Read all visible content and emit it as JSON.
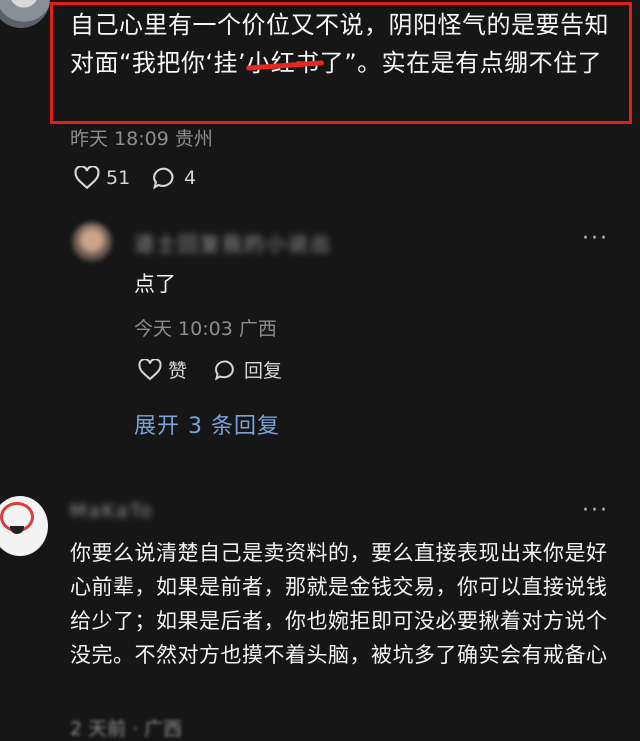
{
  "comment_main": {
    "text_before": "自己心里有一个价位又不说，阴阳怪气的是要告知对面“我把你‘挂’",
    "text_struck": "小红书",
    "text_after": "了”。实在是有点绷不住了",
    "time": "昨天 18:09",
    "location": "贵州",
    "likes": "51",
    "replies": "4"
  },
  "reply": {
    "username": "道士回复我的小说出",
    "text": "点了",
    "time": "今天 10:03",
    "location": "广西",
    "like_label": "赞",
    "reply_label": "回复",
    "more": "···"
  },
  "expand_label": "展开 3 条回复",
  "comment_second": {
    "username": "MaKaTo",
    "more": "···",
    "text": "你要么说清楚自己是卖资料的，要么直接表现出来你是好心前辈，如果是前者，那就是金钱交易，你可以直接说钱给少了；如果是后者，你也婉拒即可没必要揪着对方说个没完。不然对方也摸不着头脑，被坑多了确实会有戒备心",
    "time_partial": "2 天前 · 广西"
  }
}
